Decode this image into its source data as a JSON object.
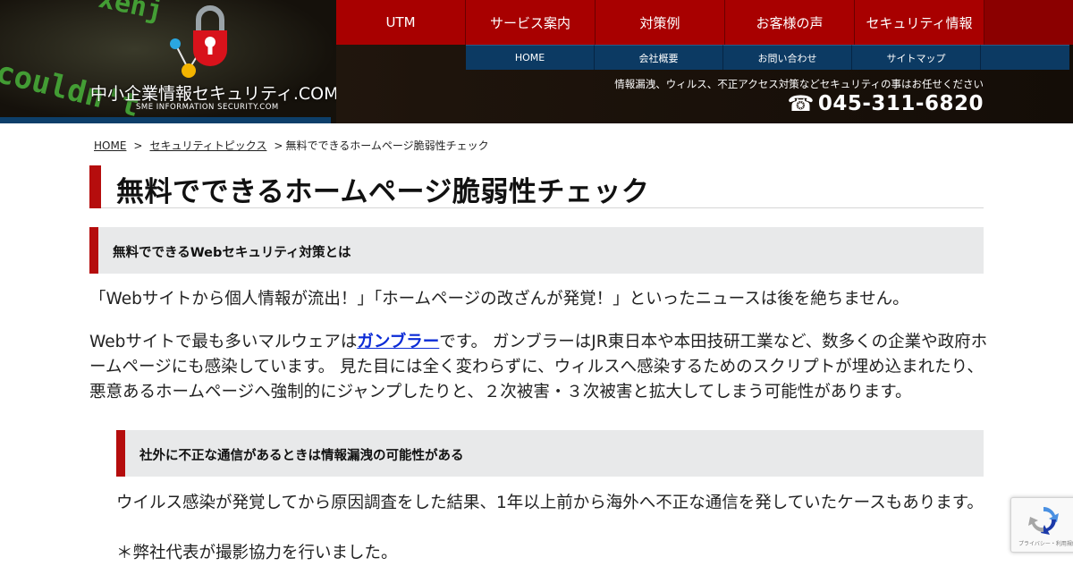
{
  "header": {
    "logo": {
      "title": "中小企業情報セキュリティ.COM",
      "subtitle": "SME INFORMATION SECURITY.COM",
      "bg_text_1": "xenj",
      "bg_text_2": "couldn't"
    },
    "nav_main": [
      {
        "label": "UTM"
      },
      {
        "label": "サービス案内"
      },
      {
        "label": "対策例"
      },
      {
        "label": "お客様の声"
      },
      {
        "label": "セキュリティ情報"
      }
    ],
    "nav_sub": [
      {
        "label": "HOME"
      },
      {
        "label": "会社概要"
      },
      {
        "label": "お問い合わせ"
      },
      {
        "label": "サイトマップ"
      }
    ],
    "tagline": "情報漏洩、ウィルス、不正アクセス対策などセキュリティの事はお任せください",
    "phone": "045-311-6820",
    "phone_icon": "☎"
  },
  "breadcrumb": {
    "home": "HOME",
    "sep1": ">",
    "category": "セキュリティトピックス",
    "sep2": ">",
    "current": "無料でできるホームページ脆弱性チェック"
  },
  "page_title": "無料でできるホームページ脆弱性チェック",
  "sections": {
    "heading_1": "無料でできるWebセキュリティ対策とは",
    "para_1": "「Webサイトから個人情報が流出！」「ホームページの改ざんが発覚！」といったニュースは後を絶ちません。",
    "para_2_before": "Webサイトで最も多いマルウェアは",
    "para_2_link": "ガンブラー",
    "para_2_after": "です。 ガンブラーはJR東日本や本田技研工業など、数多くの企業や政府ホームページにも感染しています。 見た目には全く変わらずに、ウィルスへ感染するためのスクリプトが埋め込まれたり、悪意あるホームページへ強制的にジャンプしたりと、２次被害・３次被害と拡大してしまう可能性があります。",
    "heading_2": "社外に不正な通信があるときは情報漏洩の可能性がある",
    "para_3": "ウイルス感染が発覚してから原因調査をした結果、1年以上前から海外へ不正な通信を発していたケースもあります。",
    "para_4": "＊弊社代表が撮影協力を行いました。"
  },
  "recaptcha": {
    "caption": "プライバシー・利用規約"
  },
  "colors": {
    "nav_red": "#a80000",
    "nav_blue": "#0c3a63",
    "accent_red": "#b50d0d",
    "link_blue": "#0b2bd6",
    "heading_bg": "#e8e9ea"
  }
}
